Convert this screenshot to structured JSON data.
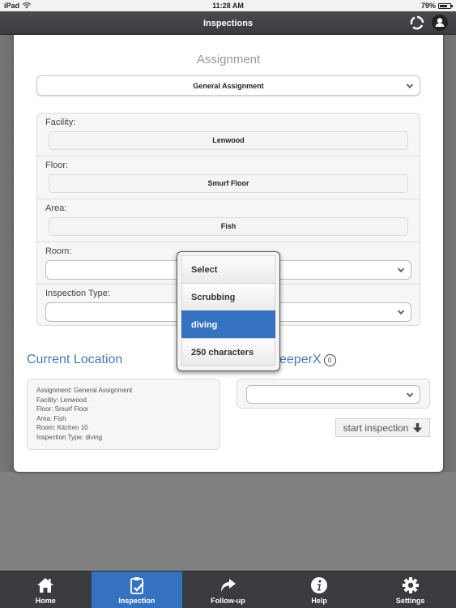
{
  "status_bar": {
    "device": "iPad",
    "time": "11:28 AM",
    "battery": "79%",
    "battery_level": 0.79
  },
  "nav": {
    "title": "Inspections",
    "refresh_icon": "refresh-icon",
    "user_icon": "user-icon"
  },
  "assignment": {
    "title": "Assignment",
    "selected": "General Assignment"
  },
  "fields": [
    {
      "label": "Facility:",
      "value": "Lenwood"
    },
    {
      "label": "Floor:",
      "value": "Smurf Floor"
    },
    {
      "label": "Area:",
      "value": "Fish"
    },
    {
      "label": "Room:",
      "value": ""
    },
    {
      "label": "Inspection Type:",
      "value": ""
    }
  ],
  "dropdown": {
    "options": [
      "Select",
      "Scrubbing",
      "diving",
      "250 characters"
    ],
    "selected_index": 2
  },
  "current_location": {
    "title": "Current Location",
    "lines": [
      "Assignment: General Assignment",
      "Facility: Lenwood",
      "Floor: Smurf Floor",
      "Area: Fish",
      "Room: Kitchen 10",
      "Inspection Type: diving"
    ]
  },
  "keeper": {
    "title": "keeperX",
    "count": "0",
    "selected": ""
  },
  "start_button": {
    "label": "start inspection",
    "icon": "arrow-down-icon"
  },
  "tabs": [
    {
      "label": "Home",
      "icon": "home-icon",
      "active": false
    },
    {
      "label": "Inspection",
      "icon": "clipboard-check-icon",
      "active": true
    },
    {
      "label": "Follow-up",
      "icon": "share-arrow-icon",
      "active": false
    },
    {
      "label": "Help",
      "icon": "info-icon",
      "active": false
    },
    {
      "label": "Settings",
      "icon": "gear-icon",
      "active": false
    }
  ],
  "colors": {
    "accent": "#3472c0",
    "link_blue": "#4a7ab5",
    "navbar": "#3b3c3f",
    "backdrop": "#808080"
  }
}
